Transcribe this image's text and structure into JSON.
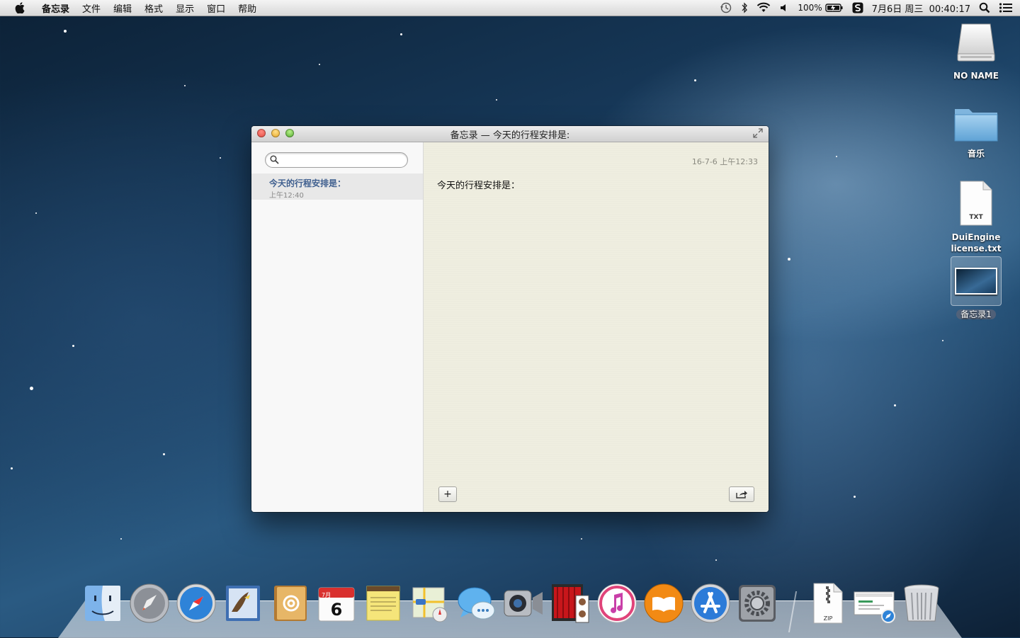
{
  "menubar": {
    "app_name": "备忘录",
    "items": [
      "文件",
      "编辑",
      "格式",
      "显示",
      "窗口",
      "帮助"
    ],
    "battery": "100%",
    "clock": "7月6日 周三  00:40:17"
  },
  "desktop": {
    "icons": [
      {
        "label": "NO NAME",
        "icon": "drive-icon"
      },
      {
        "label": "音乐",
        "icon": "folder-icon"
      },
      {
        "label": "DuiEngine license.txt",
        "icon": "txt-file-icon",
        "badge": "TXT"
      },
      {
        "label": "备忘录1",
        "icon": "screenshot-icon"
      }
    ]
  },
  "window": {
    "title": "备忘录 — 今天的行程安排是:",
    "search": {
      "placeholder": "",
      "value": ""
    },
    "notes": [
      {
        "title": "今天的行程安排是：",
        "time": "上午12:40"
      }
    ],
    "editor": {
      "date": "16-7-6 上午12:33",
      "body": "今天的行程安排是："
    },
    "add_label": "+"
  },
  "dock": {
    "items": [
      "Finder",
      "Launchpad",
      "Safari",
      "Mail",
      "通讯录",
      "日历",
      "备忘录",
      "地图",
      "信息",
      "FaceTime",
      "Photo Booth",
      "iTunes",
      "iBooks",
      "App Store",
      "系统偏好设置",
      "ZIP",
      "Screenshot",
      "废纸篓"
    ],
    "calendar_day": "6",
    "calendar_month": "7月",
    "zip_label": "ZIP"
  },
  "colors": {
    "accent": "#3f5f8f",
    "paper": "#efeee0"
  }
}
